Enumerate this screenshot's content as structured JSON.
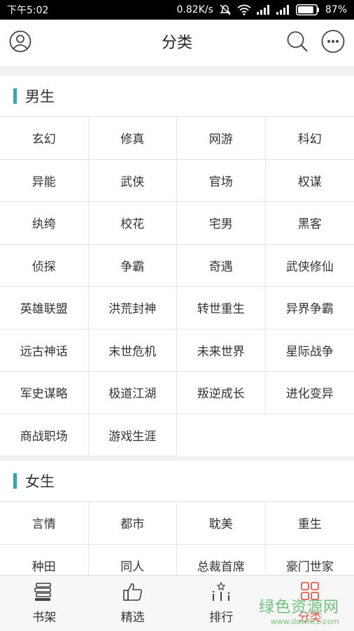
{
  "statusbar": {
    "time": "下午5:02",
    "net_speed": "0.82K/s",
    "battery": "87%",
    "battery_level": 0.87
  },
  "appbar": {
    "title": "分类",
    "icons": [
      "user-icon",
      "search-icon",
      "more-icon"
    ]
  },
  "sections": [
    {
      "title": "男生",
      "items": [
        "玄幻",
        "修真",
        "网游",
        "科幻",
        "异能",
        "武侠",
        "官场",
        "权谋",
        "纨绔",
        "校花",
        "宅男",
        "黑客",
        "侦探",
        "争霸",
        "奇遇",
        "武侠修仙",
        "英雄联盟",
        "洪荒封神",
        "转世重生",
        "异界争霸",
        "远古神话",
        "末世危机",
        "未来世界",
        "星际战争",
        "军史谋略",
        "极道江湖",
        "叛逆成长",
        "进化变异",
        "商战职场",
        "游戏生涯"
      ]
    },
    {
      "title": "女生",
      "items": [
        "言情",
        "都市",
        "耽美",
        "重生",
        "种田",
        "同人",
        "总裁首席",
        "豪门世家"
      ]
    }
  ],
  "tabbar": {
    "tabs": [
      {
        "label": "书架",
        "icon": "bookshelf-icon"
      },
      {
        "label": "精选",
        "icon": "thumbs-up-icon"
      },
      {
        "label": "排行",
        "icon": "ranking-icon"
      },
      {
        "label": "分类",
        "icon": "category-icon"
      }
    ],
    "active": "分类"
  },
  "watermark": {
    "main": "绿色资源网",
    "sub": "www.downcc.com"
  },
  "colors": {
    "accent": "#1fb1b3",
    "active_tab": "#e85a4a",
    "watermark": "#3fb34f"
  }
}
